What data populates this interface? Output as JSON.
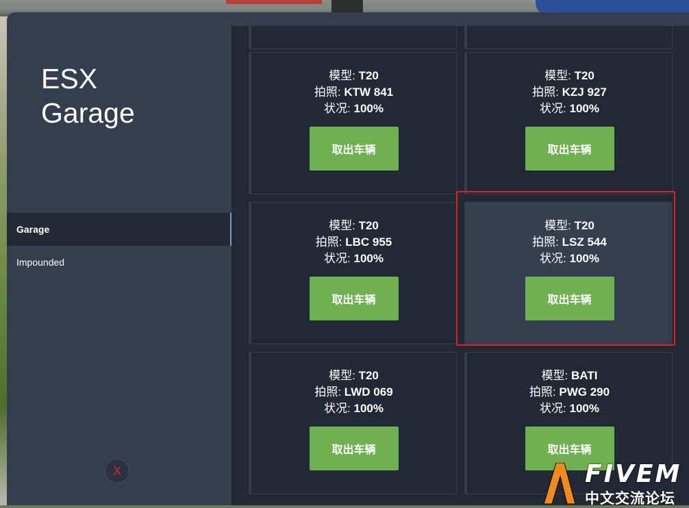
{
  "app": {
    "title_line1": "ESX",
    "title_line2": "Garage"
  },
  "sidebar": {
    "items": [
      {
        "label": "Garage",
        "active": true
      },
      {
        "label": "Impounded",
        "active": false
      }
    ],
    "close_label": "X"
  },
  "labels": {
    "model": "模型:",
    "plate": "拍照:",
    "condition": "状况:"
  },
  "vehicles": [
    {
      "model": "T20",
      "plate": "KTW 841",
      "condition": "100%",
      "button": "取出车辆"
    },
    {
      "model": "T20",
      "plate": "KZJ 927",
      "condition": "100%",
      "button": "取出车辆"
    },
    {
      "model": "T20",
      "plate": "LBC 955",
      "condition": "100%",
      "button": "取出车辆"
    },
    {
      "model": "T20",
      "plate": "LSZ 544",
      "condition": "100%",
      "button": "取出车辆",
      "selected": true
    },
    {
      "model": "T20",
      "plate": "LWD 069",
      "condition": "100%",
      "button": "取出车辆"
    },
    {
      "model": "BATI",
      "plate": "PWG 290",
      "condition": "100%",
      "button": "取出车辆"
    }
  ],
  "watermark": {
    "brand": "FIVEM",
    "subtitle": "中文交流论坛"
  },
  "colors": {
    "accent_green": "#6fb050",
    "highlight_border": "#e0201c",
    "panel": "#353e4f",
    "content": "#232835"
  }
}
